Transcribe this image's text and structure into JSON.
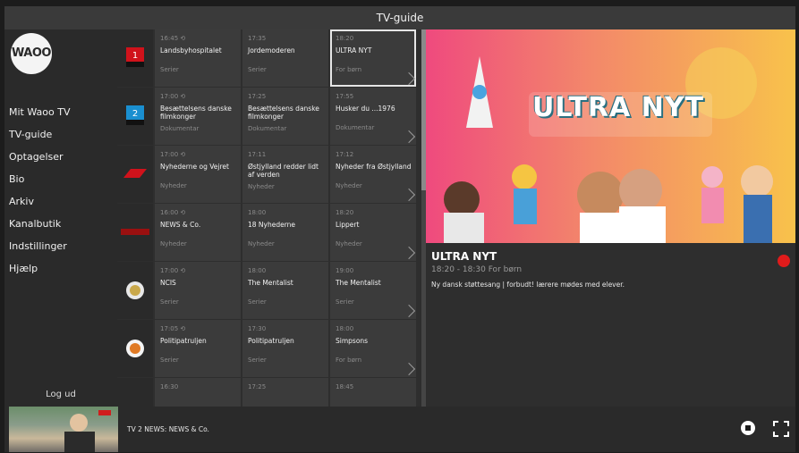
{
  "window": {
    "title": "TV-guide"
  },
  "sidebar": {
    "logo_text": "WAOO",
    "items": [
      {
        "label": "Mit Waoo TV"
      },
      {
        "label": "TV-guide"
      },
      {
        "label": "Optagelser"
      },
      {
        "label": "Bio"
      },
      {
        "label": "Arkiv"
      },
      {
        "label": "Kanalbutik"
      },
      {
        "label": "Indstillinger"
      },
      {
        "label": "Hjælp"
      }
    ],
    "logout": "Log ud"
  },
  "channels": [
    {
      "logo": "DR1",
      "programs": [
        {
          "time": "16:45 ⟲",
          "title": "Landsbyhospitalet",
          "category": "Serier"
        },
        {
          "time": "17:35",
          "title": "Jordemoderen",
          "category": "Serier"
        },
        {
          "time": "18:20",
          "title": "ULTRA NYT",
          "category": "For børn"
        }
      ]
    },
    {
      "logo": "DR2",
      "programs": [
        {
          "time": "17:00 ⟲",
          "title": "Besættelsens danske filmkonger",
          "category": "Dokumentar"
        },
        {
          "time": "17:25",
          "title": "Besættelsens danske filmkonger",
          "category": "Dokumentar"
        },
        {
          "time": "17:55",
          "title": "Husker du ...1976",
          "category": "Dokumentar"
        }
      ]
    },
    {
      "logo": "TV2",
      "programs": [
        {
          "time": "17:00 ⟲",
          "title": "Nyhederne og Vejret",
          "category": "Nyheder"
        },
        {
          "time": "17:11",
          "title": "Østjylland redder lidt af verden",
          "category": "Nyheder"
        },
        {
          "time": "17:12",
          "title": "Nyheder fra Østjylland",
          "category": "Nyheder"
        }
      ]
    },
    {
      "logo": "TV2 NEWS",
      "programs": [
        {
          "time": "16:00 ⟲",
          "title": "NEWS & Co.",
          "category": "Nyheder"
        },
        {
          "time": "18:00",
          "title": "18 Nyhederne",
          "category": "Nyheder"
        },
        {
          "time": "18:20",
          "title": "Lippert",
          "category": "Nyheder"
        }
      ]
    },
    {
      "logo": "5",
      "programs": [
        {
          "time": "17:00 ⟲",
          "title": "NCIS",
          "category": "Serier"
        },
        {
          "time": "18:00",
          "title": "The Mentalist",
          "category": "Serier"
        },
        {
          "time": "19:00",
          "title": "The Mentalist",
          "category": "Serier"
        }
      ]
    },
    {
      "logo": "kanal",
      "programs": [
        {
          "time": "17:05 ⟲",
          "title": "Politipatruljen",
          "category": "Serier"
        },
        {
          "time": "17:30",
          "title": "Politipatruljen",
          "category": "Serier"
        },
        {
          "time": "18:00",
          "title": "Simpsons",
          "category": "For børn"
        }
      ]
    },
    {
      "logo": "",
      "programs": [
        {
          "time": "16:30",
          "title": "",
          "category": ""
        },
        {
          "time": "17:25",
          "title": "",
          "category": ""
        },
        {
          "time": "18:45",
          "title": "",
          "category": ""
        }
      ]
    }
  ],
  "detail": {
    "hero_text": "ULTRA NYT",
    "title": "ULTRA NYT",
    "time_category": "18:20 - 18:30  For børn",
    "description": "Ny dansk støttesang | forbudt! lærere mødes med elever."
  },
  "player": {
    "now_playing": "TV 2 NEWS: NEWS & Co."
  },
  "colors": {
    "record": "#e01b1b",
    "accent": "#e6e6e6"
  }
}
